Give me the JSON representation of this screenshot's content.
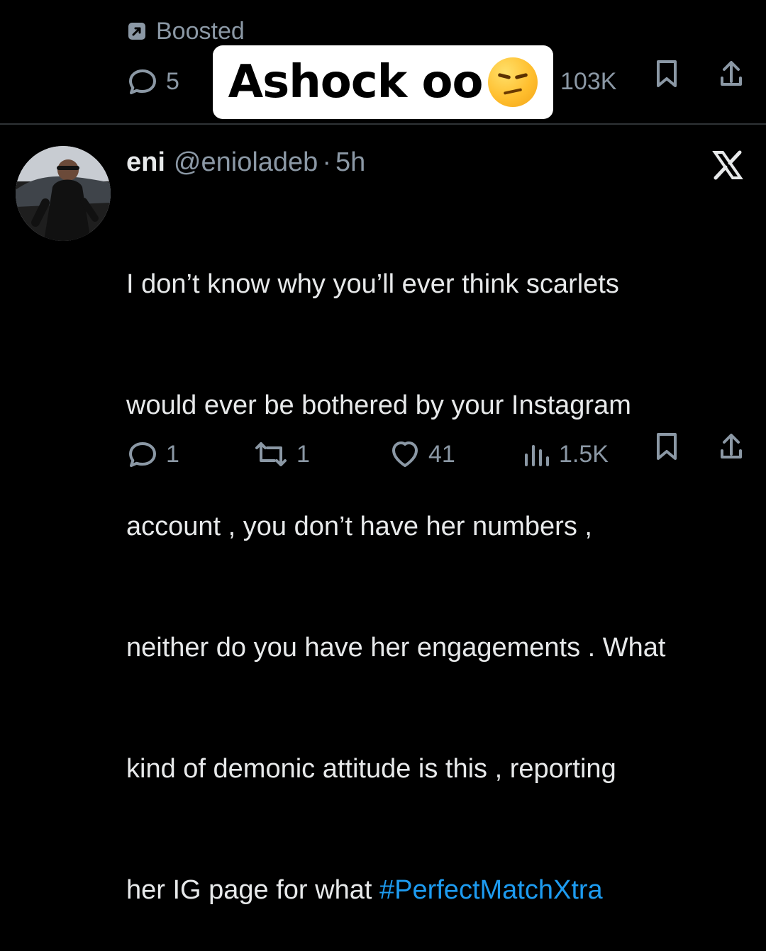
{
  "top_post": {
    "boosted_label": "Boosted",
    "reply_count": "5",
    "view_count": "103K"
  },
  "overlay": {
    "text": "Ashock oo",
    "emoji": "😒"
  },
  "tweet": {
    "display_name": "eni",
    "handle": "@enioladeb",
    "separator": "·",
    "time": "5h",
    "body_lines": [
      "I don’t know why you’ll ever think scarlets",
      "would ever be bothered by your Instagram",
      "account , you don’t have her numbers ,",
      "neither do you have her engagements . What",
      "kind of demonic attitude is this , reporting"
    ],
    "last_line_text": "her IG page for what ",
    "hashtag": "#PerfectMatchXtra",
    "reply_count": "1",
    "repost_count": "1",
    "like_count": "41",
    "view_count": "1.5K"
  },
  "icons": {
    "boosted": "boosted-icon",
    "reply": "reply-icon",
    "repost": "repost-icon",
    "like": "heart-icon",
    "views": "views-icon",
    "bookmark": "bookmark-icon",
    "share": "share-icon",
    "logo": "x-logo-icon"
  },
  "colors": {
    "background": "#000000",
    "text": "#e7e9ea",
    "muted": "#8b98a5",
    "link": "#1d9bf0",
    "divider": "#2f3336",
    "overlay": "#ffffff"
  }
}
